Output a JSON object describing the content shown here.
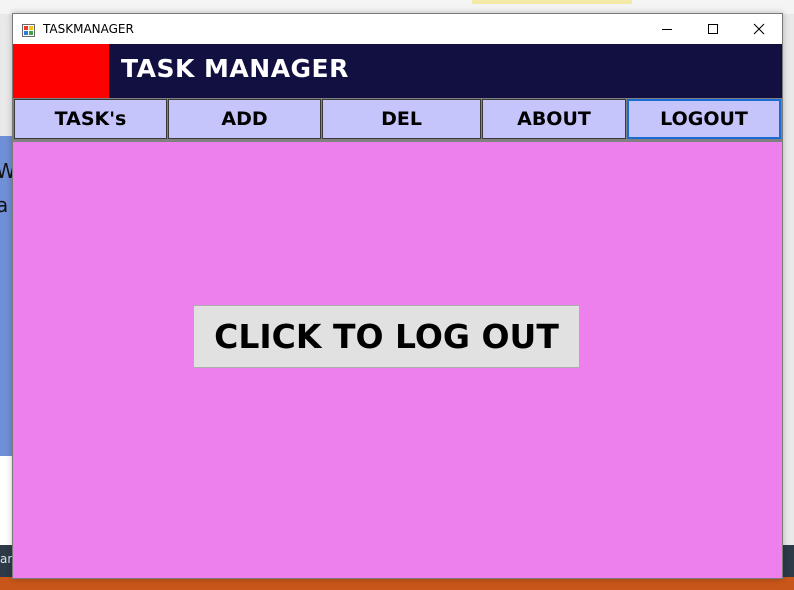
{
  "window": {
    "title": "TASKMANAGER"
  },
  "header": {
    "title": "TASK MANAGER",
    "logo_color": "#ff0000",
    "background_color": "#121040"
  },
  "nav": {
    "items": [
      {
        "label": "TASK's"
      },
      {
        "label": "ADD"
      },
      {
        "label": "DEL"
      },
      {
        "label": "ABOUT"
      },
      {
        "label": "LOGOUT",
        "active": true
      }
    ],
    "button_color": "#c5c5fb"
  },
  "main": {
    "logout_button_label": "CLICK TO LOG OUT",
    "background_color": "#ee80ee"
  },
  "background": {
    "left_text": "W a",
    "taskbar_text": "ar"
  },
  "icons": {
    "app": "app-icon",
    "minimize": "minimize-icon",
    "maximize": "maximize-icon",
    "close": "close-icon"
  }
}
